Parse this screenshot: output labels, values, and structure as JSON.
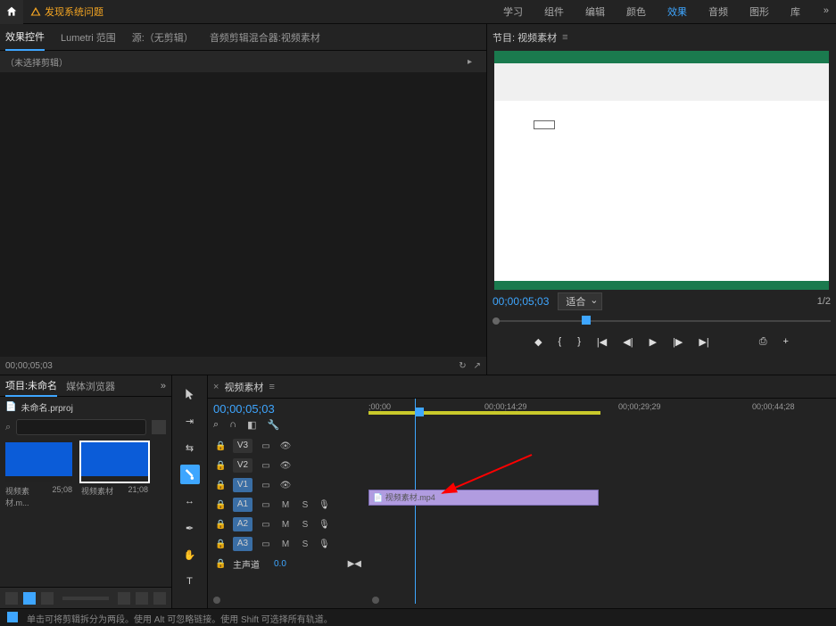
{
  "topbar": {
    "warning": "发现系统问题",
    "nav": [
      "学习",
      "组件",
      "编辑",
      "颜色",
      "效果",
      "音频",
      "图形",
      "库"
    ],
    "active_nav": "效果"
  },
  "panels": {
    "effect_controls": "效果控件",
    "lumetri_scope": "Lumetri 范围",
    "source": "源:（无剪辑）",
    "audio_mixer": "音频剪辑混合器:视频素材",
    "no_clip": "（未选择剪辑）",
    "program": "节目: 视频素材",
    "project": "项目:未命名",
    "media_browser": "媒体浏览器",
    "prproj": "未命名.prproj"
  },
  "timecodes": {
    "left_foot": "00;00;05;03",
    "program": "00;00;05;03",
    "tl_current": "00;00;05;03",
    "ruler": [
      ";00;00",
      "00;00;14;29",
      "00;00;29;29",
      "00;00;44;28"
    ]
  },
  "program": {
    "fit": "适合",
    "ratio": "1/2"
  },
  "bins": {
    "clip1_name": "视频素材.m...",
    "clip1_dur": "25;08",
    "clip2_name": "视频素材",
    "clip2_dur": "21;08"
  },
  "timeline": {
    "seq_name": "视频素材",
    "tracks_v": [
      "V3",
      "V2",
      "V1"
    ],
    "tracks_a": [
      "A1",
      "A2",
      "A3"
    ],
    "master": "主声道",
    "master_val": "0.0",
    "clip_label": "📄 视频素材.mp4",
    "letters": {
      "m": "M",
      "s": "S"
    }
  },
  "footer": {
    "hint": "单击可将剪辑拆分为两段。使用 Alt 可忽略链接。使用 Shift 可选择所有轨道。"
  }
}
